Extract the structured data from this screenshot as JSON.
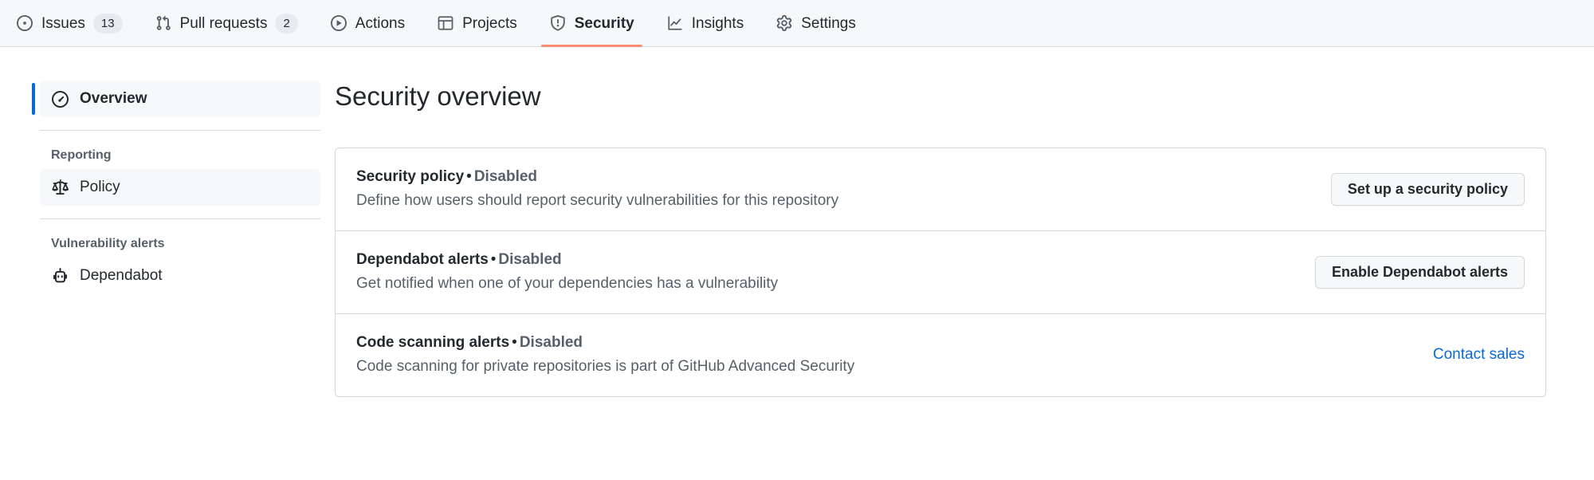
{
  "repo_nav": {
    "items": [
      {
        "label": "Issues",
        "icon": "issue-opened-icon",
        "count": "13",
        "selected": false
      },
      {
        "label": "Pull requests",
        "icon": "git-pull-request-icon",
        "count": "2",
        "selected": false
      },
      {
        "label": "Actions",
        "icon": "play-icon",
        "count": "",
        "selected": false
      },
      {
        "label": "Projects",
        "icon": "table-icon",
        "count": "",
        "selected": false
      },
      {
        "label": "Security",
        "icon": "shield-icon",
        "count": "",
        "selected": true
      },
      {
        "label": "Insights",
        "icon": "graph-icon",
        "count": "",
        "selected": false
      },
      {
        "label": "Settings",
        "icon": "gear-icon",
        "count": "",
        "selected": false
      }
    ],
    "selected_accent": "#fd8c73"
  },
  "sidebar": {
    "overview": {
      "label": "Overview",
      "icon": "meter-icon"
    },
    "reporting_heading": "Reporting",
    "policy": {
      "label": "Policy",
      "icon": "law-icon"
    },
    "vulnerability_heading": "Vulnerability alerts",
    "dependabot": {
      "label": "Dependabot",
      "icon": "dependabot-icon"
    },
    "active_accent": "#0969da"
  },
  "main": {
    "title": "Security overview",
    "separator": "•",
    "rows": [
      {
        "name": "Security policy",
        "state": "Disabled",
        "description": "Define how users should report security vulnerabilities for this repository",
        "action_type": "button",
        "action_label": "Set up a security policy"
      },
      {
        "name": "Dependabot alerts",
        "state": "Disabled",
        "description": "Get notified when one of your dependencies has a vulnerability",
        "action_type": "button",
        "action_label": "Enable Dependabot alerts"
      },
      {
        "name": "Code scanning alerts",
        "state": "Disabled",
        "description": "Code scanning for private repositories is part of GitHub Advanced Security",
        "action_type": "link",
        "action_label": "Contact sales"
      }
    ],
    "link_color": "#0969da"
  }
}
